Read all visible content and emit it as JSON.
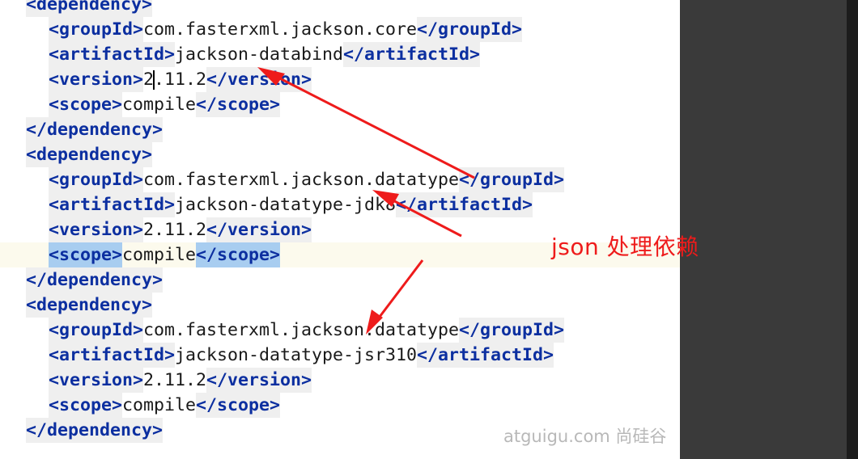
{
  "editor": {
    "lines": [
      {
        "indent": "  ",
        "open": "<dependency>",
        "text": "",
        "close": ""
      },
      {
        "indent": "    ",
        "open": "<groupId>",
        "text": "com.fasterxml.jackson.core",
        "close": "</groupId>"
      },
      {
        "indent": "    ",
        "open": "<artifactId>",
        "text": "jackson-databind",
        "close": "</artifactId>"
      },
      {
        "indent": "    ",
        "open": "<version>",
        "text": "2.11.2",
        "close": "</version>"
      },
      {
        "indent": "    ",
        "open": "<scope>",
        "text": "compile",
        "close": "</scope>"
      },
      {
        "indent": "  ",
        "open": "</dependency>",
        "text": "",
        "close": ""
      },
      {
        "indent": "  ",
        "open": "<dependency>",
        "text": "",
        "close": ""
      },
      {
        "indent": "    ",
        "open": "<groupId>",
        "text": "com.fasterxml.jackson.datatype",
        "close": "</groupId>"
      },
      {
        "indent": "    ",
        "open": "<artifactId>",
        "text": "jackson-datatype-jdk8",
        "close": "</artifactId>"
      },
      {
        "indent": "    ",
        "open": "<version>",
        "text": "2.11.2",
        "close": "</version>"
      },
      {
        "indent": "    ",
        "open": "<scope>",
        "text": "compile",
        "close": "</scope>",
        "highlight": true
      },
      {
        "indent": "  ",
        "open": "</dependency>",
        "text": "",
        "close": ""
      },
      {
        "indent": "  ",
        "open": "<dependency>",
        "text": "",
        "close": ""
      },
      {
        "indent": "    ",
        "open": "<groupId>",
        "text": "com.fasterxml.jackson.datatype",
        "close": "</groupId>"
      },
      {
        "indent": "    ",
        "open": "<artifactId>",
        "text": "jackson-datatype-jsr310",
        "close": "</artifactId>"
      },
      {
        "indent": "    ",
        "open": "<version>",
        "text": "2.11.2",
        "close": "</version>"
      },
      {
        "indent": "    ",
        "open": "<scope>",
        "text": "compile",
        "close": "</scope>"
      },
      {
        "indent": "  ",
        "open": "</dependency>",
        "text": "",
        "close": ""
      }
    ]
  },
  "annotation": {
    "text": "json 处理依赖",
    "color": "#ee1b1b"
  },
  "watermark": "atguigu.com 尚硅谷",
  "colors": {
    "tag": "#0c2fa0",
    "tag_bg": "#efefef",
    "matched_tag_bg": "#a8cdf0",
    "current_line_bg": "#fcfaed",
    "side_panel": "#3a3a3a"
  }
}
